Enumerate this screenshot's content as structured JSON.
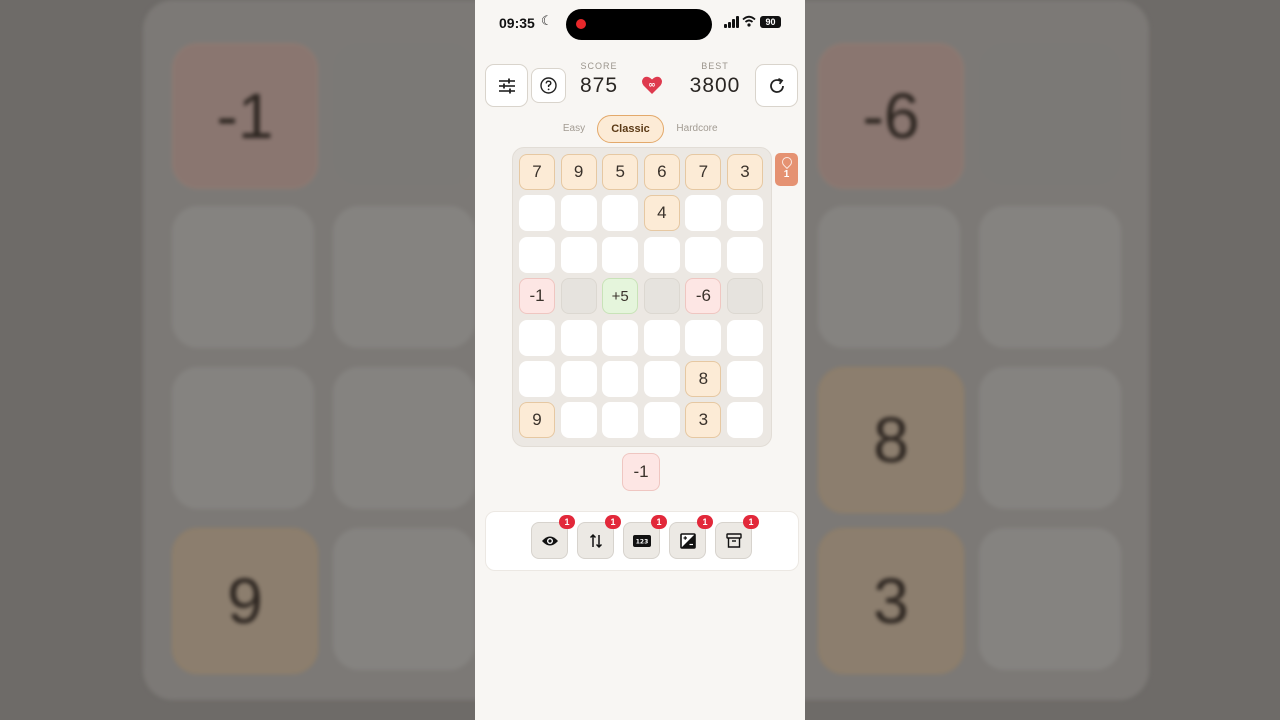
{
  "status_bar": {
    "time": "09:35",
    "battery": "90"
  },
  "header": {
    "score_label": "SCORE",
    "score_value": "875",
    "best_label": "BEST",
    "best_value": "3800",
    "lives": "∞"
  },
  "difficulty": {
    "options": [
      "Easy",
      "Classic",
      "Hardcore"
    ],
    "selected": "Classic"
  },
  "board": {
    "rows": [
      [
        "7",
        "9",
        "5",
        "6",
        "7",
        "3"
      ],
      [
        "",
        "",
        "",
        "4",
        "",
        ""
      ],
      [
        "",
        "",
        "",
        "",
        "",
        ""
      ],
      [
        "-1",
        "·",
        "+5",
        "·",
        "-6",
        "·"
      ],
      [
        "",
        "",
        "",
        "",
        "",
        ""
      ],
      [
        "",
        "",
        "",
        "",
        "8",
        ""
      ],
      [
        "9",
        "",
        "",
        "",
        "3",
        ""
      ]
    ]
  },
  "side_tag": {
    "count": "1"
  },
  "next_tile": "-1",
  "tools": [
    {
      "icon": "eye-icon",
      "badge": "1"
    },
    {
      "icon": "swap-arrows-icon",
      "badge": "1"
    },
    {
      "icon": "numbers-icon",
      "label": "123",
      "badge": "1"
    },
    {
      "icon": "contrast-icon",
      "badge": "1"
    },
    {
      "icon": "archive-icon",
      "badge": "1"
    }
  ],
  "background_tiles": [
    "-1",
    "-6",
    "8",
    "9",
    "3"
  ]
}
